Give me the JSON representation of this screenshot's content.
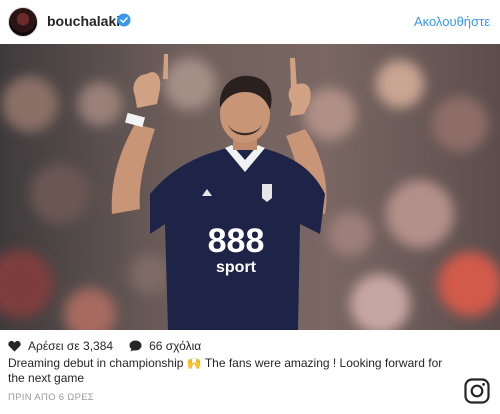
{
  "post": {
    "username": "bouchalakis",
    "verified": true,
    "follow_label": "Ακολουθήστε",
    "likes_text": "Αρέσει σε 3,384",
    "comments_text": "66 σχόλια",
    "caption": "Dreaming debut in championship 🙌 The fans were amazing ! Looking forward for the next game",
    "timestamp": "ΠΡΙΝ ΑΠΟ 6 ΩΡΕΣ",
    "shirt_sponsor_top": "888",
    "shirt_sponsor_bottom": "sport",
    "icons": [
      "verified-badge-icon",
      "heart-icon",
      "comment-icon",
      "instagram-logo-icon"
    ]
  },
  "colors": {
    "accent": "#3897f0",
    "text": "#262626",
    "muted": "#999999"
  }
}
